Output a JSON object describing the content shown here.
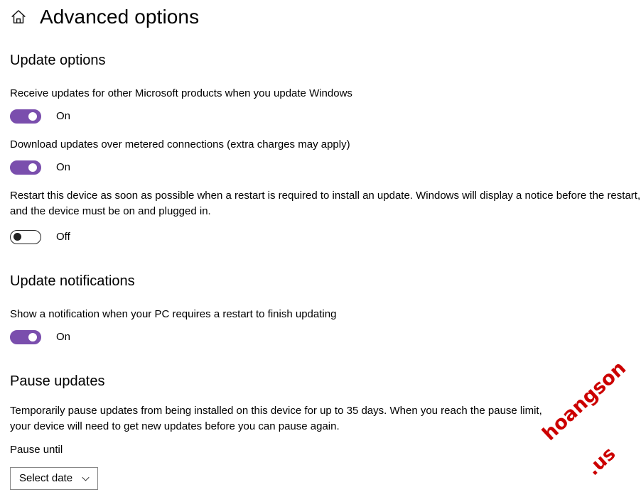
{
  "header": {
    "home_icon": "home-icon",
    "title": "Advanced options"
  },
  "sections": {
    "update_options": {
      "heading": "Update options",
      "settings": [
        {
          "label": "Receive updates for other Microsoft products when you update Windows",
          "toggle_state": "On"
        },
        {
          "label": "Download updates over metered connections (extra charges may apply)",
          "toggle_state": "On"
        },
        {
          "label": "Restart this device as soon as possible when a restart is required to install an update. Windows will display a notice before the restart, and the device must be on and plugged in.",
          "toggle_state": "Off"
        }
      ]
    },
    "update_notifications": {
      "heading": "Update notifications",
      "settings": [
        {
          "label": "Show a notification when your PC requires a restart to finish updating",
          "toggle_state": "On"
        }
      ]
    },
    "pause_updates": {
      "heading": "Pause updates",
      "description": "Temporarily pause updates from being installed on this device for up to 35 days. When you reach the pause limit, your device will need to get new updates before you can pause again.",
      "field_label": "Pause until",
      "dropdown": {
        "value": "Select date",
        "icon": "chevron-down-icon"
      }
    }
  },
  "watermark": {
    "line1": "hoangson",
    "line2": ".us"
  },
  "colors": {
    "toggle_on": "#7a4ead",
    "toggle_off_border": "#222222",
    "dropdown_border": "#888888",
    "watermark": "#cc0000",
    "text": "#000000"
  }
}
